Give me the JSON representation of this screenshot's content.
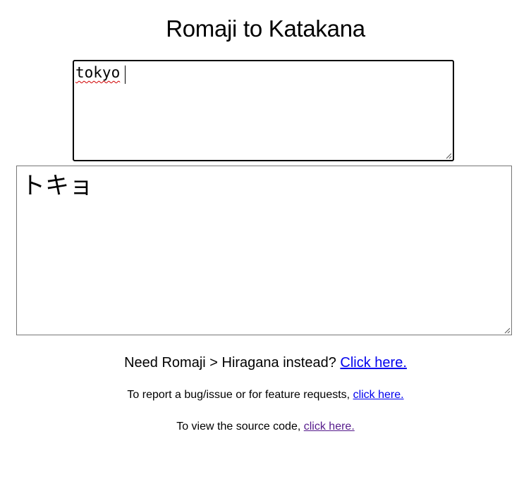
{
  "page": {
    "title": "Romaji to Katakana"
  },
  "converter": {
    "input_value": "tokyo",
    "output_value": "トキョ"
  },
  "links": {
    "hiragana_prompt": "Need Romaji > Hiragana instead? ",
    "hiragana_link": "Click here.",
    "bug_prompt": "To report a bug/issue or for feature requests, ",
    "bug_link": "click here.",
    "source_prompt": "To view the source code, ",
    "source_link": "click here."
  },
  "colors": {
    "link": "#0000ee",
    "visited_link": "#551a8b",
    "spellcheck_underline": "#d00000"
  }
}
